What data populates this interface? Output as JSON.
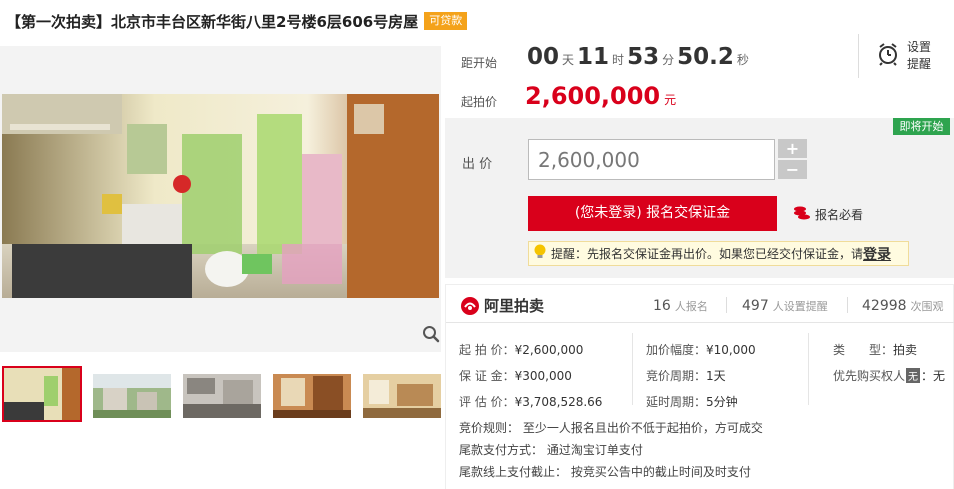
{
  "title": {
    "text": "【第一次拍卖】北京市丰台区新华街八里2号楼6层606号房屋",
    "badge": "可贷款"
  },
  "countdown": {
    "label": "距开始",
    "days": "00",
    "days_unit": "天",
    "hours": "11",
    "hours_unit": "时",
    "minutes": "53",
    "minutes_unit": "分",
    "seconds": "50.2",
    "seconds_unit": "秒"
  },
  "start_price": {
    "label": "起拍价",
    "value": "2,600,000",
    "unit": "元"
  },
  "remind": {
    "label": "设置提醒",
    "icon": "alarm-clock-icon"
  },
  "bid": {
    "status_badge": "即将开始",
    "label": "出 价",
    "input_value": "2,600,000",
    "plus": "+",
    "minus": "−",
    "deposit_button": "(您未登录) 报名交保证金",
    "must_read": "报名必看",
    "tip_text": "提醒：先报名交保证金再出价。如果您已经交付保证金，请",
    "tip_link": "登录"
  },
  "stats": {
    "brand": "阿里拍卖",
    "signups": "16",
    "signups_label": "人报名",
    "reminders": "497",
    "reminders_label": "人设置提醒",
    "views": "42998",
    "views_label": "次围观"
  },
  "details": {
    "start_price_label": "起 拍 价：",
    "start_price_value": "¥2,600,000",
    "deposit_label": "保 证 金：",
    "deposit_value": "¥300,000",
    "appraisal_label": "评 估 价：",
    "appraisal_value": "¥3,708,528.66",
    "increment_label": "加价幅度：",
    "increment_value": "¥10,000",
    "cycle_label": "竞价周期：",
    "cycle_value": "1天",
    "delay_label": "延时周期：",
    "delay_value": "5分钟",
    "type_label": "类　　型：",
    "type_value": "拍卖",
    "priority_label": "优先购买权人",
    "priority_badge": "无",
    "priority_value": "：无"
  },
  "rules": {
    "bid_rule_label": "竞价规则：",
    "bid_rule_value": "至少一人报名且出价不低于起拍价，方可成交",
    "pay_method_label": "尾款支付方式：",
    "pay_method_value": "通过淘宝订单支付",
    "offline_label": "尾款线上支付截止：",
    "offline_value": "按竞买公告中的截止时间及时支付"
  },
  "colors": {
    "accent_red": "#d9001b",
    "badge_orange": "#f4a21a",
    "status_green": "#2ea44f"
  }
}
